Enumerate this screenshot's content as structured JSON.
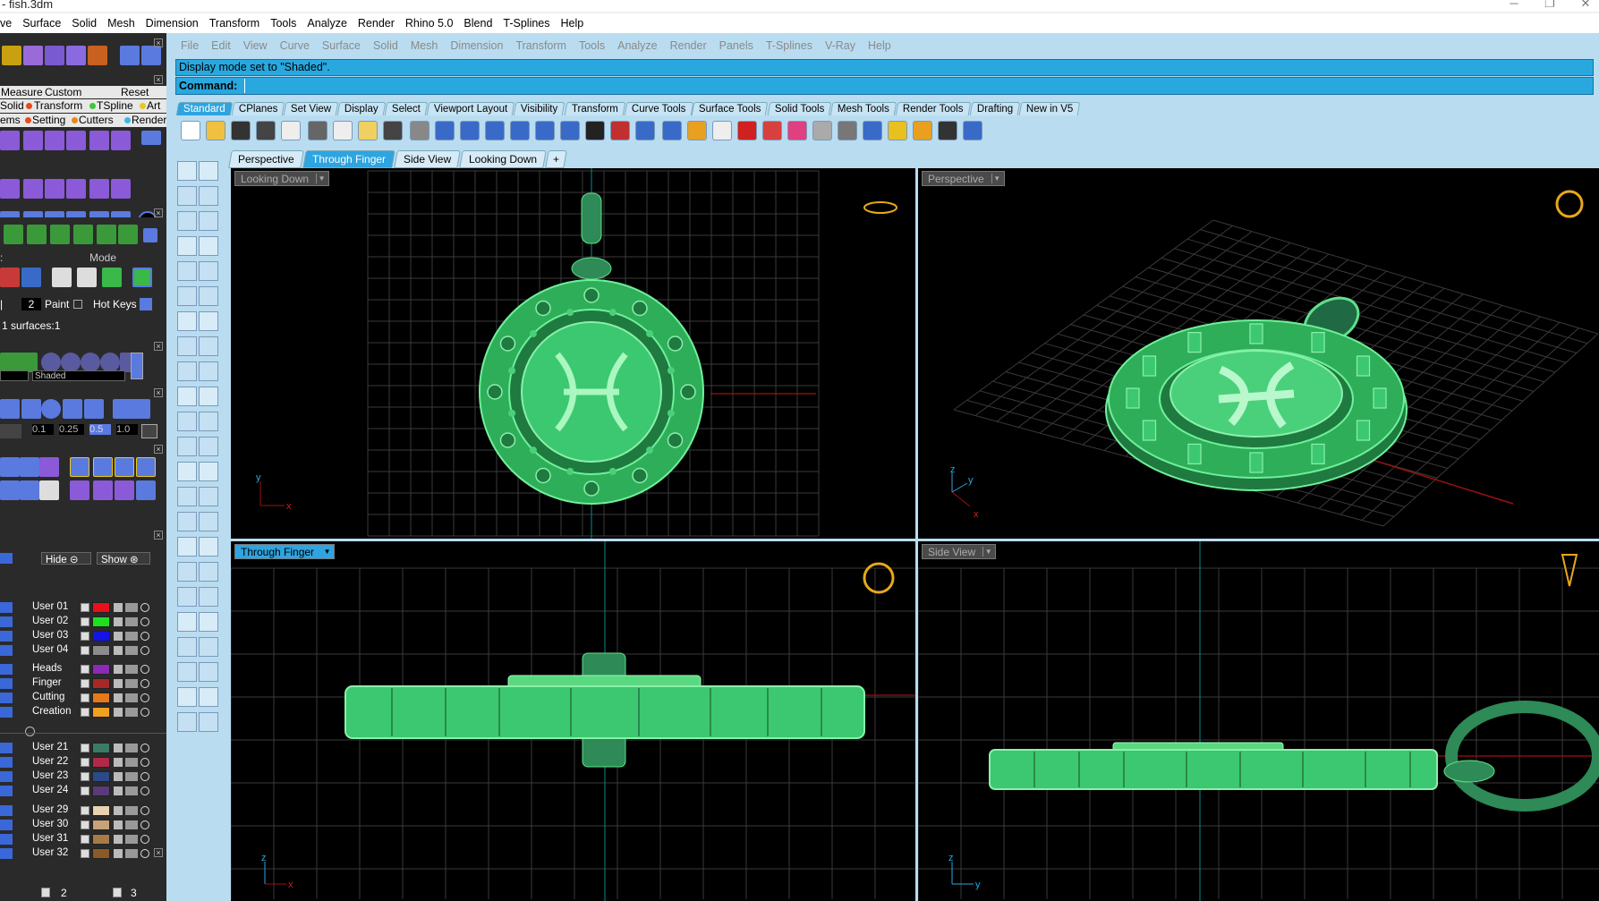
{
  "window": {
    "title": "- fish.3dm",
    "controls": [
      "─",
      "❐",
      "✕"
    ]
  },
  "menubar": [
    "ve",
    "Surface",
    "Solid",
    "Mesh",
    "Dimension",
    "Transform",
    "Tools",
    "Analyze",
    "Render",
    "Rhino 5.0",
    "Blend",
    "T-Splines",
    "Help"
  ],
  "rhino_menu": [
    "File",
    "Edit",
    "View",
    "Curve",
    "Surface",
    "Solid",
    "Mesh",
    "Dimension",
    "Transform",
    "Tools",
    "Analyze",
    "Render",
    "Panels",
    "T-Splines",
    "V-Ray",
    "Help"
  ],
  "command": {
    "history": "Display mode set to \"Shaded\".",
    "prompt_label": "Command:",
    "value": ""
  },
  "toolbar_tabs": [
    "Standard",
    "CPlanes",
    "Set View",
    "Display",
    "Select",
    "Viewport Layout",
    "Visibility",
    "Transform",
    "Curve Tools",
    "Surface Tools",
    "Solid Tools",
    "Mesh Tools",
    "Render Tools",
    "Drafting",
    "New in V5"
  ],
  "viewport_tabs": [
    "Perspective",
    "Through Finger",
    "Side View",
    "Looking Down",
    "+"
  ],
  "viewports": {
    "top_left": "Looking Down",
    "top_right": "Perspective",
    "bottom_left": "Through Finger",
    "bottom_right": "Side View"
  },
  "axes": {
    "x": "x",
    "y": "y",
    "z": "z"
  },
  "left_panel": {
    "measure": "Measure",
    "custom": "Custom",
    "reset": "Reset",
    "cat_row1": [
      "Solid",
      "Transform",
      "TSpline",
      "Art"
    ],
    "cat_row2": [
      "ems",
      "Setting",
      "Cutters",
      "Render"
    ],
    "mode": "Mode",
    "paint_value": "2",
    "paint": "Paint",
    "hot_keys": "Hot Keys",
    "surfaces_info": "1 surfaces:1",
    "display_mode": "Shaded",
    "tol": [
      "0.1",
      "0.25",
      "0.5",
      "1.0"
    ],
    "hide": "Hide",
    "show": "Show",
    "pager": [
      "2",
      "3"
    ]
  },
  "layers": [
    {
      "name": "User 01",
      "color": "#e8101a"
    },
    {
      "name": "User 02",
      "color": "#1ee01e"
    },
    {
      "name": "User 03",
      "color": "#1414e6"
    },
    {
      "name": "User 04",
      "color": "#8c8c8c"
    },
    {
      "name": "Heads",
      "color": "#8a2ab8"
    },
    {
      "name": "Finger",
      "color": "#a82828"
    },
    {
      "name": "Cutting",
      "color": "#e87818"
    },
    {
      "name": "Creation",
      "color": "#f0a020"
    },
    {
      "name": "User 21",
      "color": "#3a7a66"
    },
    {
      "name": "User 22",
      "color": "#b02a48"
    },
    {
      "name": "User 23",
      "color": "#2a4a8a"
    },
    {
      "name": "User 24",
      "color": "#5a3a7a"
    },
    {
      "name": "User 29",
      "color": "#e8d2b0"
    },
    {
      "name": "User 30",
      "color": "#c8a278"
    },
    {
      "name": "User 31",
      "color": "#a87a4a"
    },
    {
      "name": "User 32",
      "color": "#8a5a28"
    }
  ],
  "colors": {
    "accent": "#2ea4e0",
    "model_green": "#3ccf6a",
    "grid": "#3a3a3a"
  }
}
